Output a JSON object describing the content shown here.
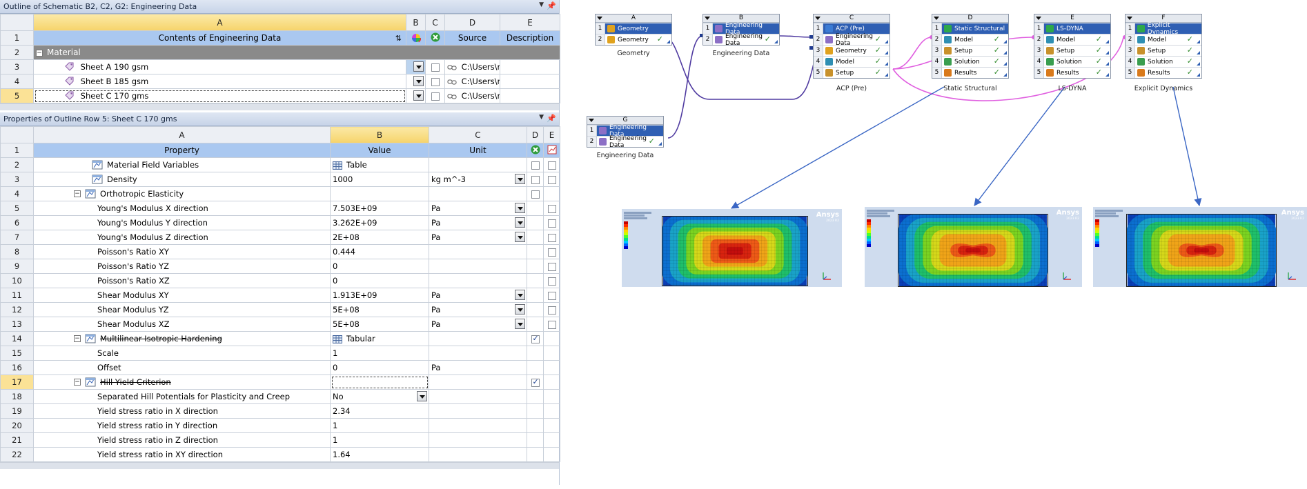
{
  "outline": {
    "title": "Outline of Schematic B2, C2, G2: Engineering Data",
    "columns": [
      "A",
      "B",
      "C",
      "D",
      "E"
    ],
    "header": {
      "contents": "Contents of Engineering Data",
      "source": "Source",
      "description": "Description"
    },
    "group": "Material",
    "rows": [
      {
        "num": "1"
      },
      {
        "num": "2"
      },
      {
        "num": "3",
        "name": "Sheet A 190 gsm",
        "source": "C:\\Users\\r"
      },
      {
        "num": "4",
        "name": "Sheet B 185 gsm",
        "source": "C:\\Users\\r"
      },
      {
        "num": "5",
        "name": "Sheet C 170 gms",
        "source": "C:\\Users\\r"
      }
    ]
  },
  "properties": {
    "title": "Properties of Outline Row 5: Sheet C 170 gms",
    "columns": [
      "A",
      "B",
      "C",
      "D",
      "E"
    ],
    "header": {
      "property": "Property",
      "value": "Value",
      "unit": "Unit"
    },
    "rows": [
      {
        "num": "1"
      },
      {
        "num": "2",
        "property": "Material Field Variables",
        "value": "Table",
        "unit": ""
      },
      {
        "num": "3",
        "property": "Density",
        "value": "1000",
        "unit": "kg m^-3"
      },
      {
        "num": "4",
        "property": "Orthotropic Elasticity",
        "value": "",
        "unit": ""
      },
      {
        "num": "5",
        "property": "Young's Modulus X direction",
        "value": "7.503E+09",
        "unit": "Pa"
      },
      {
        "num": "6",
        "property": "Young's Modulus Y direction",
        "value": "3.262E+09",
        "unit": "Pa"
      },
      {
        "num": "7",
        "property": "Young's Modulus Z direction",
        "value": "2E+08",
        "unit": "Pa"
      },
      {
        "num": "8",
        "property": "Poisson's Ratio XY",
        "value": "0.444",
        "unit": ""
      },
      {
        "num": "9",
        "property": "Poisson's Ratio YZ",
        "value": "0",
        "unit": ""
      },
      {
        "num": "10",
        "property": "Poisson's Ratio XZ",
        "value": "0",
        "unit": ""
      },
      {
        "num": "11",
        "property": "Shear Modulus XY",
        "value": "1.913E+09",
        "unit": "Pa"
      },
      {
        "num": "12",
        "property": "Shear Modulus YZ",
        "value": "5E+08",
        "unit": "Pa"
      },
      {
        "num": "13",
        "property": "Shear Modulus XZ",
        "value": "5E+08",
        "unit": "Pa"
      },
      {
        "num": "14",
        "property": "Multilinear Isotropic Hardening",
        "value": "Tabular",
        "unit": ""
      },
      {
        "num": "15",
        "property": "Scale",
        "value": "1",
        "unit": ""
      },
      {
        "num": "16",
        "property": "Offset",
        "value": "0",
        "unit": "Pa"
      },
      {
        "num": "17",
        "property": "Hill Yield Criterion",
        "value": "",
        "unit": ""
      },
      {
        "num": "18",
        "property": "Separated Hill Potentials for Plasticity and Creep",
        "value": "No",
        "unit": ""
      },
      {
        "num": "19",
        "property": "Yield stress ratio in X direction",
        "value": "2.34",
        "unit": ""
      },
      {
        "num": "20",
        "property": "Yield stress ratio in Y direction",
        "value": "1",
        "unit": ""
      },
      {
        "num": "21",
        "property": "Yield stress ratio in Z direction",
        "value": "1",
        "unit": ""
      },
      {
        "num": "22",
        "property": "Yield stress ratio in XY direction",
        "value": "1.64",
        "unit": ""
      }
    ]
  },
  "schematic": {
    "systems": [
      {
        "letter": "A",
        "cells": [
          "Geometry",
          "Geometry"
        ],
        "label": "Geometry"
      },
      {
        "letter": "B",
        "cells": [
          "Engineering Data",
          "Engineering Data"
        ],
        "label": "Engineering Data"
      },
      {
        "letter": "C",
        "cells": [
          "ACP (Pre)",
          "Engineering Data",
          "Geometry",
          "Model",
          "Setup"
        ],
        "label": "ACP (Pre)"
      },
      {
        "letter": "D",
        "cells": [
          "Static Structural",
          "Model",
          "Setup",
          "Solution",
          "Results"
        ],
        "label": "Static Structural"
      },
      {
        "letter": "E",
        "cells": [
          "LS-DYNA",
          "Model",
          "Setup",
          "Solution",
          "Results"
        ],
        "label": "LS-DYNA"
      },
      {
        "letter": "F",
        "cells": [
          "Explicit Dynamics",
          "Model",
          "Setup",
          "Solution",
          "Results"
        ],
        "label": "Explicit Dynamics"
      },
      {
        "letter": "G",
        "cells": [
          "Engineering Data",
          "Engineering Data"
        ],
        "label": "Engineering Data"
      }
    ]
  },
  "results": {
    "brand": "Ansys",
    "version": "2023 R2"
  },
  "colors": {
    "selection": "#fbe296",
    "header_blue": "#aac8f0",
    "group_gray": "#8a8a8a",
    "cell_blue": "#2f5fb3",
    "link_purple": "#4f3aa0",
    "link_pink": "#e060e0",
    "arrow_blue": "#3a66c4"
  }
}
